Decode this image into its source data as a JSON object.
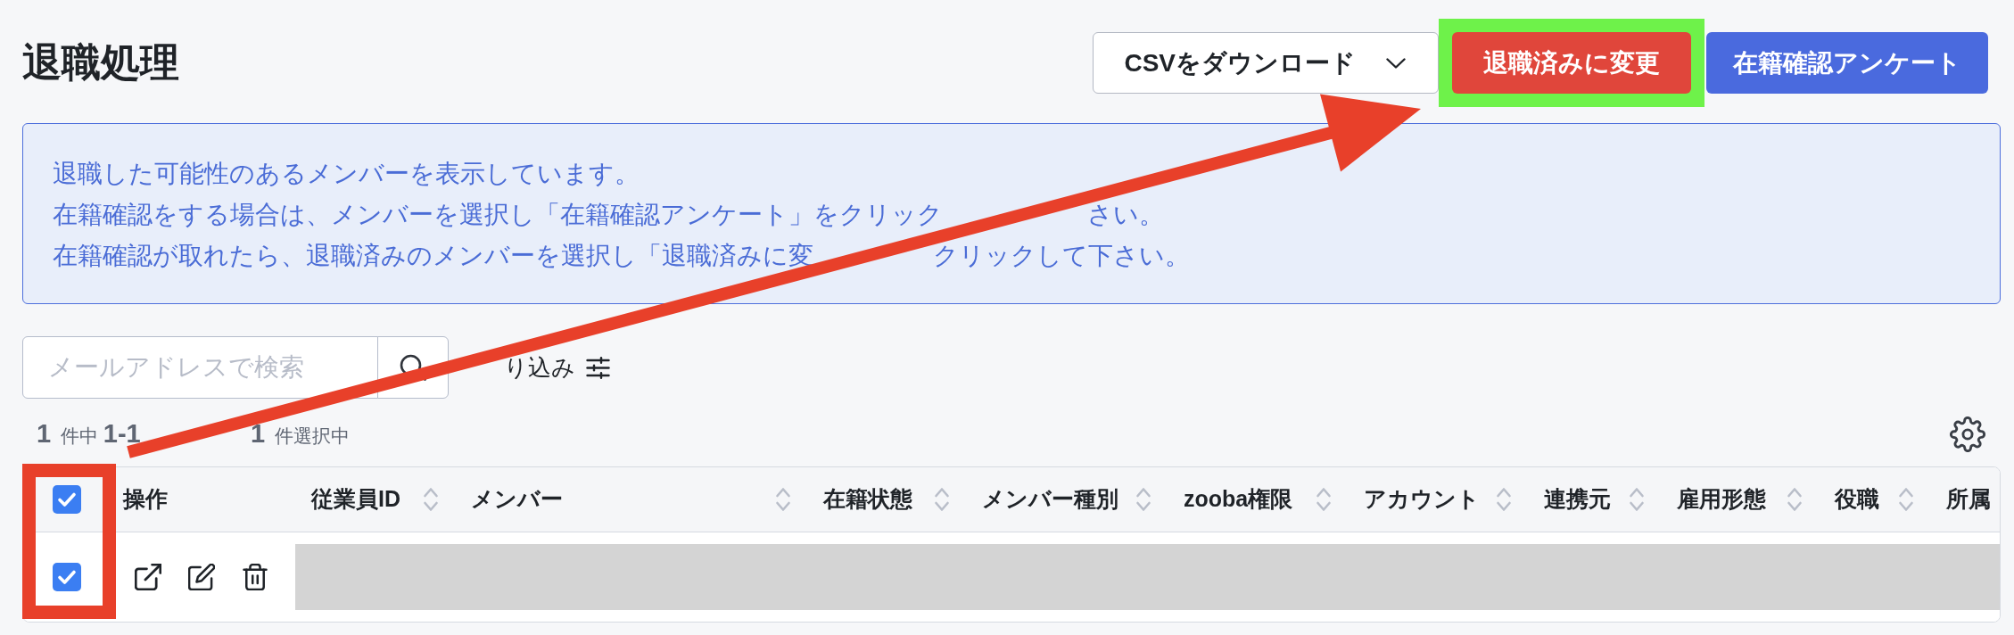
{
  "page": {
    "title": "退職処理"
  },
  "actions": [
    {
      "kind": "dropdown",
      "label": "CSVをダウンロード",
      "highlighted": false
    },
    {
      "kind": "danger",
      "label": "退職済みに変更",
      "highlighted": true
    },
    {
      "kind": "primary",
      "label": "在籍確認アンケート",
      "highlighted": false
    }
  ],
  "notice": {
    "lines": [
      {
        "parts": [
          "退職した可能性のあるメンバーを表示しています。"
        ]
      },
      {
        "parts": [
          "在籍確認をする場合は、メンバーを選択し「在籍確認アンケート」をクリック",
          "さい。"
        ]
      },
      {
        "parts": [
          "在籍確認が取れたら、退職済みのメンバーを選択し「退職済みに変",
          "クリックして下さい。"
        ]
      }
    ]
  },
  "search": {
    "placeholder": "メールアドレスで検索"
  },
  "filter": {
    "label": "り込み"
  },
  "summary": {
    "range": "**1** 件中 **1-1**",
    "selection": "**1** 件選択中"
  },
  "table": {
    "select_all_checked": true,
    "checkbox_column_highlighted": true,
    "columns": [
      {
        "label": "操作",
        "sortable": false
      },
      {
        "label": "従業員ID",
        "sortable": true
      },
      {
        "label": "メンバー",
        "sortable": true
      },
      {
        "label": "在籍状態",
        "sortable": true
      },
      {
        "label": "メンバー種別",
        "sortable": true
      },
      {
        "label": "zooba権限",
        "sortable": true
      },
      {
        "label": "アカウント",
        "sortable": true
      },
      {
        "label": "連携元",
        "sortable": true
      },
      {
        "label": "雇用形態",
        "sortable": true
      },
      {
        "label": "役職",
        "sortable": true
      },
      {
        "label": "所属",
        "sortable": false
      }
    ],
    "rows": [
      {
        "checked": true,
        "redacted": true
      }
    ]
  },
  "annotation_arrow": true
}
